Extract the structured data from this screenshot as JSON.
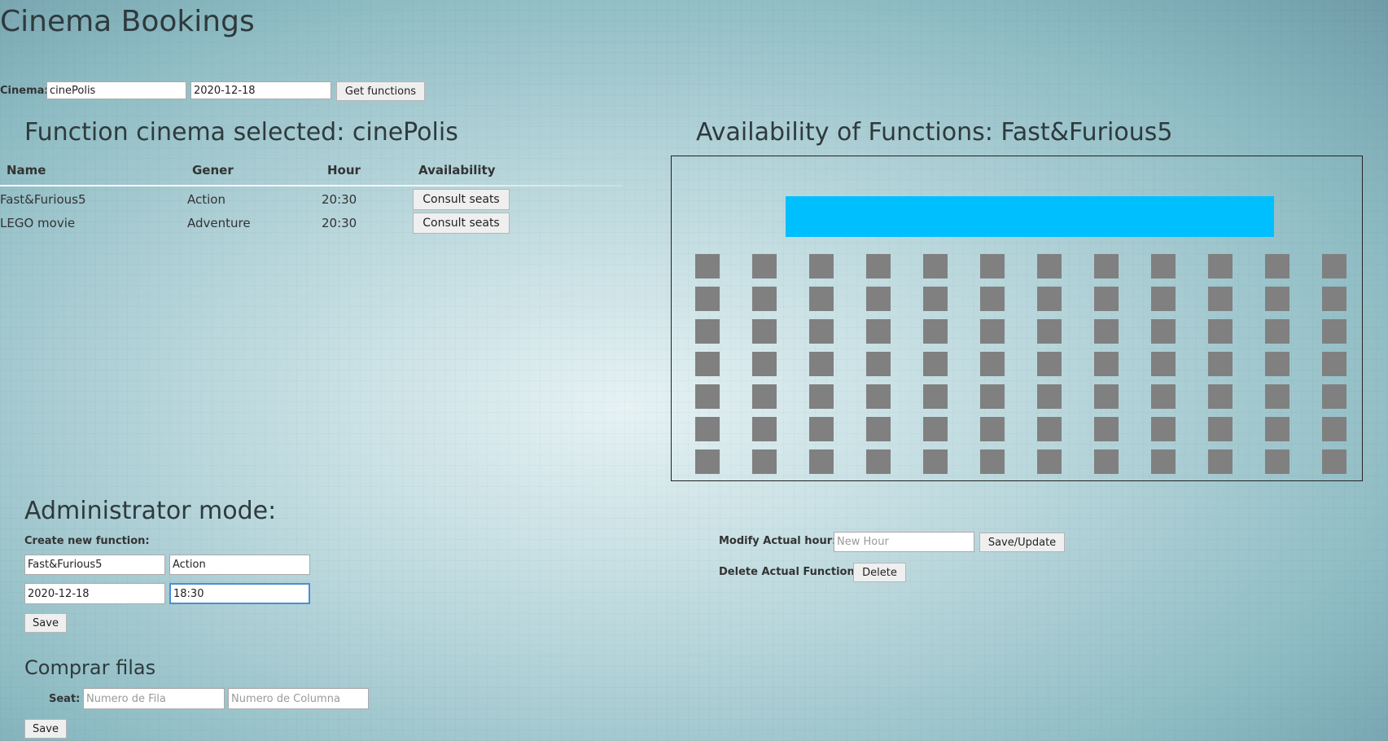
{
  "title": "Cinema Bookings",
  "cinema_form": {
    "label": "Cinema:",
    "cinema_value": "cinePolis",
    "date_value": "2020-12-18",
    "get_button": "Get functions"
  },
  "functions": {
    "heading": "Function cinema selected: cinePolis",
    "columns": [
      "Name",
      "Gener",
      "Hour",
      "Availability"
    ],
    "rows": [
      {
        "name": "Fast&Furious5",
        "genre": "Action",
        "hour": "20:30",
        "action": "Consult seats"
      },
      {
        "name": "LEGO movie",
        "genre": "Adventure",
        "hour": "20:30",
        "action": "Consult seats"
      }
    ]
  },
  "availability": {
    "heading": "Availability of Functions: Fast&Furious5",
    "screen_color": "#00bfff",
    "seat_color": "#808080",
    "rows": 7,
    "cols": 12
  },
  "admin": {
    "heading": "Administrator mode:",
    "create_label": "Create new function:",
    "name_value": "Fast&Furious5",
    "genre_value": "Action",
    "date_value": "2020-12-18",
    "hour_value": "18:30",
    "save_button": "Save",
    "modify_label": "Modify Actual hour:",
    "new_hour_placeholder": "New Hour",
    "update_button": "Save/Update",
    "delete_label": "Delete Actual Function:",
    "delete_button": "Delete"
  },
  "buy": {
    "heading": "Comprar filas",
    "seat_label": "Seat:",
    "row_placeholder": "Numero de Fila",
    "col_placeholder": "Numero de Columna",
    "save_button": "Save"
  }
}
